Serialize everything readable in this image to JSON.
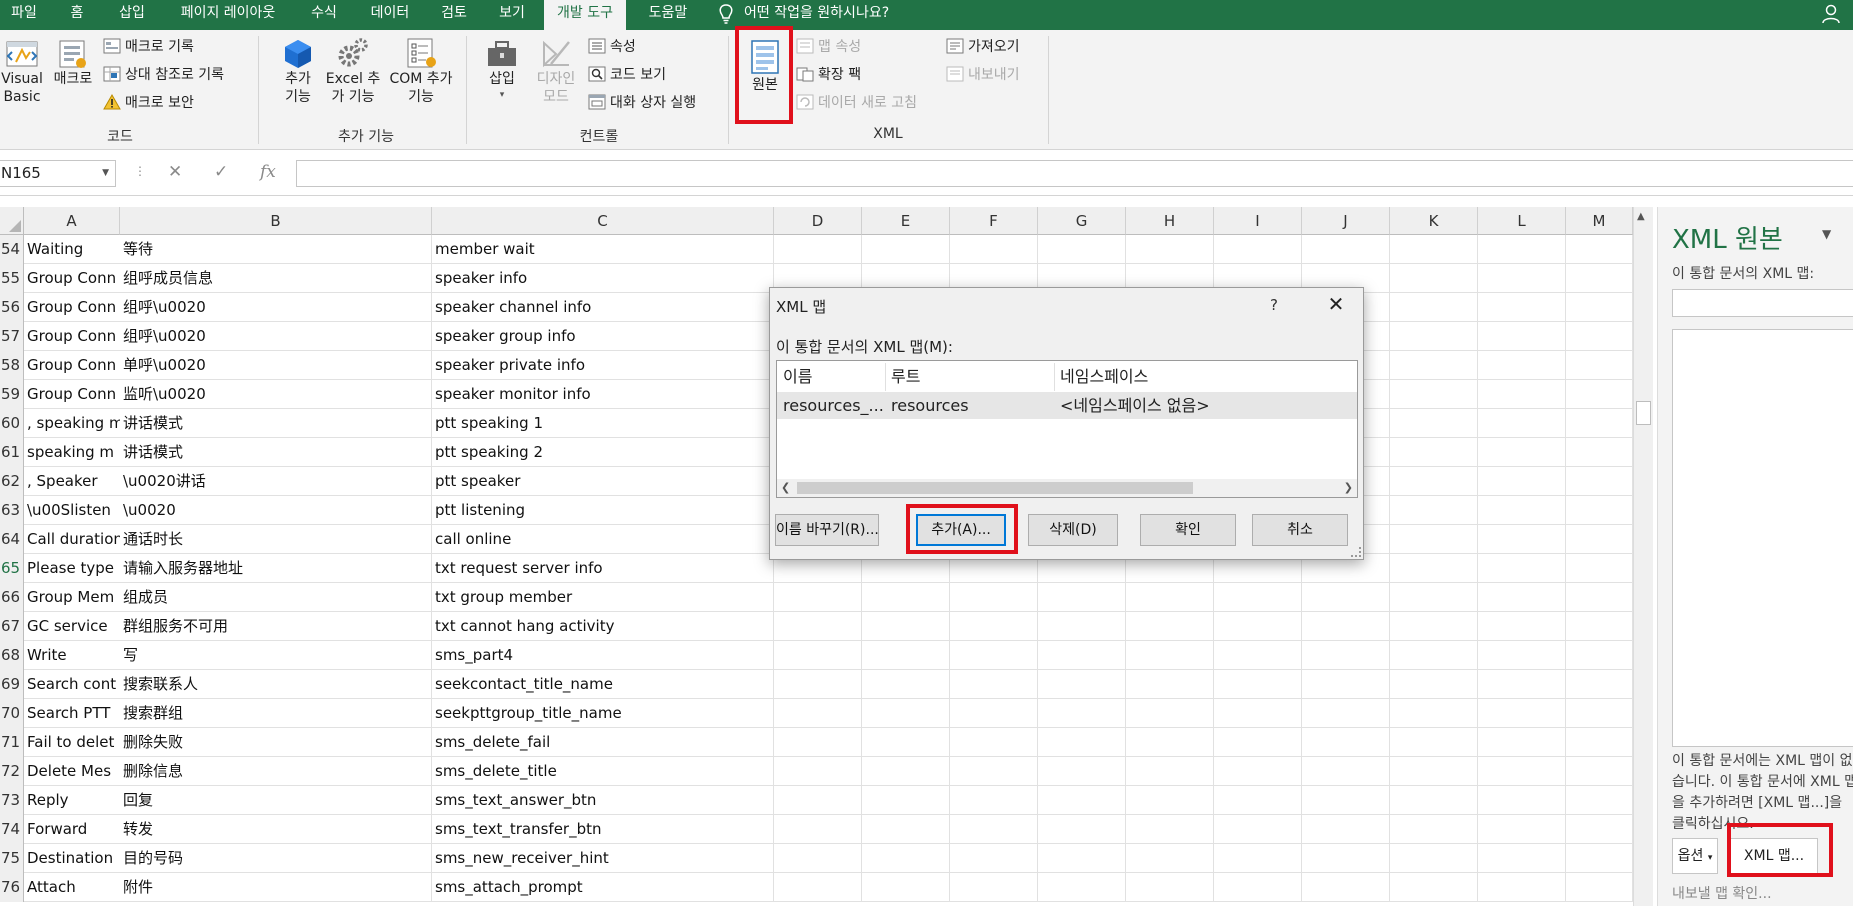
{
  "ribbon_tabs": [
    "파일",
    "홈",
    "삽입",
    "페이지 레이아웃",
    "수식",
    "데이터",
    "검토",
    "보기",
    "개발 도구",
    "도움말"
  ],
  "active_tab": "개발 도구",
  "tell_me": "어떤 작업을 원하시나요?",
  "ribbon": {
    "code": {
      "visual_basic": "Visual Basic",
      "macro": "매크로",
      "record_macro": "매크로 기록",
      "relative_ref": "상대 참조로 기록",
      "macro_security": "매크로 보안",
      "label": "코드"
    },
    "addins": {
      "addins": "추가 기능",
      "excel_addins": "Excel 추가 기능",
      "com_addins": "COM 추가 기능",
      "label": "추가 기능"
    },
    "controls": {
      "insert": "삽입",
      "design_mode": "디자인 모드",
      "properties": "속성",
      "view_code": "코드 보기",
      "run_dialog": "대화 상자 실행",
      "label": "컨트롤"
    },
    "xml": {
      "source": "원본",
      "map_properties": "맵 속성",
      "expansion_packs": "확장 팩",
      "refresh_data": "데이터 새로 고침",
      "import": "가져오기",
      "export": "내보내기",
      "label": "XML"
    }
  },
  "formula_bar": {
    "name_box": "N165",
    "cancel": "✕",
    "enter": "✓",
    "fx": "fx",
    "value": ""
  },
  "columns": [
    "A",
    "B",
    "C",
    "D",
    "E",
    "F",
    "G",
    "H",
    "I",
    "J",
    "K",
    "L",
    "M"
  ],
  "rows": [
    {
      "num": "54",
      "a": "Waiting",
      "b": "等待",
      "c": "member wait"
    },
    {
      "num": "55",
      "a": "Group Conn",
      "b": "组呼成员信息",
      "c": "speaker info"
    },
    {
      "num": "56",
      "a": "Group Conn",
      "b": "组呼\\u0020",
      "c": "speaker channel info"
    },
    {
      "num": "57",
      "a": "Group Conn",
      "b": "组呼\\u0020",
      "c": "speaker group info"
    },
    {
      "num": "58",
      "a": "Group Conn",
      "b": "单呼\\u0020",
      "c": "speaker private info"
    },
    {
      "num": "59",
      "a": "Group Conn",
      "b": "监听\\u0020",
      "c": "speaker monitor info"
    },
    {
      "num": "60",
      "a": ", speaking m",
      "b": "讲话模式",
      "c": "ptt speaking 1"
    },
    {
      "num": "61",
      "a": "speaking m",
      "b": "讲话模式",
      "c": "ptt speaking 2"
    },
    {
      "num": "62",
      "a": ", Speaker",
      "b": "\\u0020讲话",
      "c": "ptt speaker"
    },
    {
      "num": "63",
      "a": "\\u00Slisten",
      "b": "\\u0020",
      "c": "ptt listening"
    },
    {
      "num": "64",
      "a": "Call duration",
      "b": "通话时长",
      "c": "call online"
    },
    {
      "num": "65",
      "a": "Please type",
      "b": "请输入服务器地址",
      "c": "txt request server info"
    },
    {
      "num": "66",
      "a": "Group Mem",
      "b": "组成员",
      "c": "txt group member"
    },
    {
      "num": "67",
      "a": "GC service",
      "b": "群组服务不可用",
      "c": "txt cannot hang activity"
    },
    {
      "num": "68",
      "a": "Write",
      "b": "写",
      "c": "sms_part4"
    },
    {
      "num": "69",
      "a": "Search cont",
      "b": "搜索联系人",
      "c": "seekcontact_title_name"
    },
    {
      "num": "70",
      "a": "Search PTT",
      "b": "搜索群组",
      "c": "seekpttgroup_title_name"
    },
    {
      "num": "71",
      "a": "Fail to delet",
      "b": "删除失败",
      "c": "sms_delete_fail"
    },
    {
      "num": "72",
      "a": "Delete Mes",
      "b": "删除信息",
      "c": "sms_delete_title"
    },
    {
      "num": "73",
      "a": "Reply",
      "b": "回复",
      "c": "sms_text_answer_btn"
    },
    {
      "num": "74",
      "a": "Forward",
      "b": "转发",
      "c": "sms_text_transfer_btn"
    },
    {
      "num": "75",
      "a": "Destination",
      "b": "目的号码",
      "c": "sms_new_receiver_hint"
    },
    {
      "num": "76",
      "a": "Attach",
      "b": "附件",
      "c": "sms_attach_prompt"
    }
  ],
  "selected_row": "65",
  "dialog": {
    "title": "XML 맵",
    "help": "?",
    "close": "✕",
    "list_label": "이 통합 문서의 XML 맵(M):",
    "headers": [
      "이름",
      "루트",
      "네임스페이스"
    ],
    "entries": [
      {
        "name": "resources_...",
        "root": "resources",
        "namespace": "<네임스페이스 없음>"
      }
    ],
    "buttons": {
      "rename": "이름 바꾸기(R)...",
      "add": "추가(A)...",
      "delete": "삭제(D)",
      "ok": "확인",
      "cancel": "취소"
    }
  },
  "task_pane": {
    "title": "XML 원본",
    "maps_label": "이 통합 문서의 XML 맵:",
    "message": "이 통합 문서에는 XML 맵이 없습니다. 이 통합 문서에 XML 맵을 추가하려면 [XML 맵...]을 클릭하십시오.",
    "options": "옵션",
    "xml_maps_button": "XML 맵...",
    "verify_export": "내보낼 맵 확인..."
  },
  "colors": {
    "ribbon_green": "#217346",
    "highlight_red": "#e0101b"
  }
}
